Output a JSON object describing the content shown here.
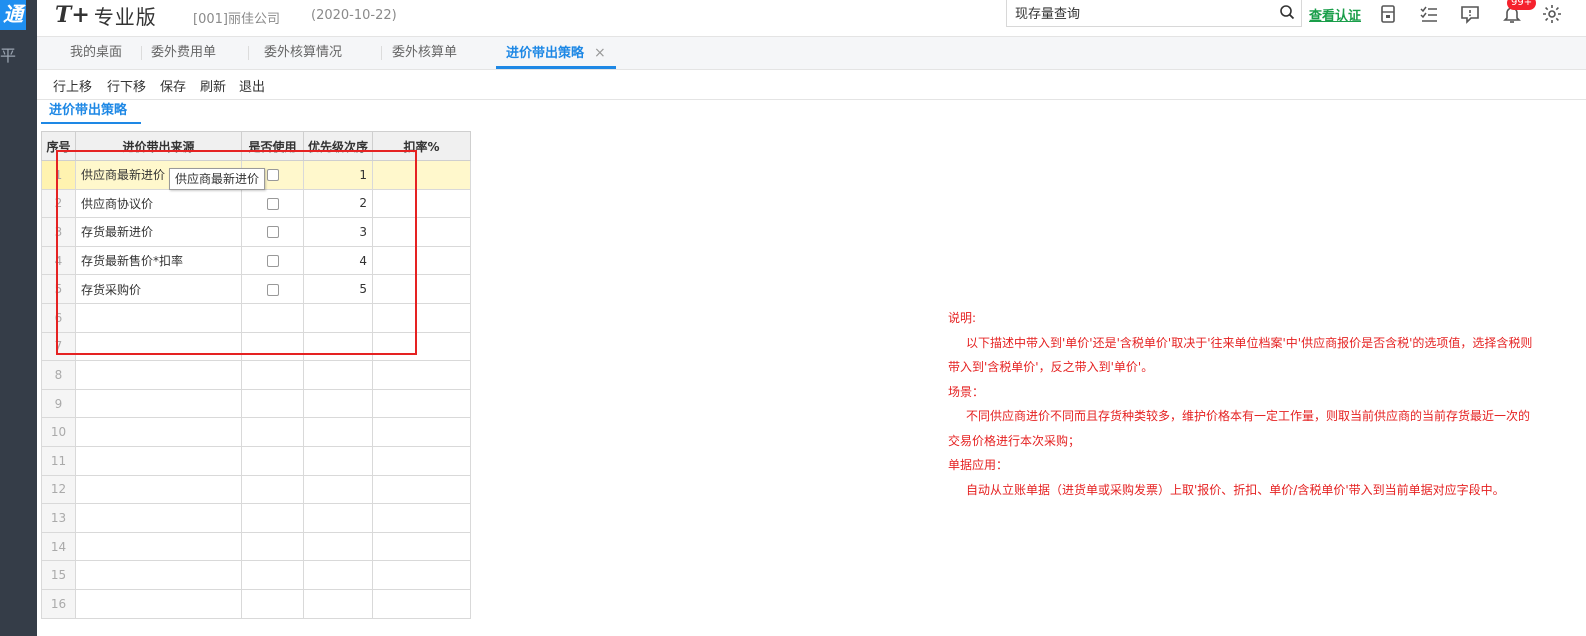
{
  "sidebar": {
    "logo_glyph": "通",
    "rail_glyph": "平"
  },
  "header": {
    "brand_mark": "T+",
    "brand_name": "专业版",
    "company": "[001]丽佳公司",
    "date": "(2020-10-22)",
    "search": {
      "value": "现存量查询",
      "placeholder": ""
    },
    "auth_link": "查看认证",
    "badge_count": "99+"
  },
  "tabs": [
    {
      "label": "我的桌面",
      "active": false
    },
    {
      "label": "委外费用单",
      "active": false
    },
    {
      "label": "委外核算情况",
      "active": false
    },
    {
      "label": "委外核算单",
      "active": false
    },
    {
      "label": "进价带出策略",
      "active": true,
      "close": "×"
    }
  ],
  "toolbar": [
    "行上移",
    "行下移",
    "保存",
    "刷新",
    "退出"
  ],
  "subtab": "进价带出策略",
  "grid": {
    "columns": [
      "序号",
      "进价带出来源",
      "是否使用",
      "优先级次序",
      "扣率%"
    ],
    "rows": [
      {
        "no": "1",
        "source": "供应商最新进价",
        "used": false,
        "priority": "1",
        "discount": "",
        "selected": true
      },
      {
        "no": "2",
        "source": "供应商协议价",
        "used": false,
        "priority": "2",
        "discount": ""
      },
      {
        "no": "3",
        "source": "存货最新进价",
        "used": false,
        "priority": "3",
        "discount": ""
      },
      {
        "no": "4",
        "source": "存货最新售价*扣率",
        "used": false,
        "priority": "4",
        "discount": ""
      },
      {
        "no": "5",
        "source": "存货采购价",
        "used": false,
        "priority": "5",
        "discount": ""
      },
      {
        "no": "6",
        "source": "",
        "used": null,
        "priority": "",
        "discount": ""
      },
      {
        "no": "7",
        "source": "",
        "used": null,
        "priority": "",
        "discount": ""
      },
      {
        "no": "8",
        "source": "",
        "used": null,
        "priority": "",
        "discount": ""
      },
      {
        "no": "9",
        "source": "",
        "used": null,
        "priority": "",
        "discount": ""
      },
      {
        "no": "10",
        "source": "",
        "used": null,
        "priority": "",
        "discount": ""
      },
      {
        "no": "11",
        "source": "",
        "used": null,
        "priority": "",
        "discount": ""
      },
      {
        "no": "12",
        "source": "",
        "used": null,
        "priority": "",
        "discount": ""
      },
      {
        "no": "13",
        "source": "",
        "used": null,
        "priority": "",
        "discount": ""
      },
      {
        "no": "14",
        "source": "",
        "used": null,
        "priority": "",
        "discount": ""
      },
      {
        "no": "15",
        "source": "",
        "used": null,
        "priority": "",
        "discount": ""
      },
      {
        "no": "16",
        "source": "",
        "used": null,
        "priority": "",
        "discount": ""
      }
    ]
  },
  "tooltip": "供应商最新进价",
  "notes": {
    "title1": "说明:",
    "body1": "以下描述中带入到'单价'还是'含税单价'取决于'往来单位档案'中'供应商报价是否含税'的选项值，选择含税则带入到'含税单价'，反之带入到'单价'。",
    "title2": "场景：",
    "body2": "不同供应商进价不同而且存货种类较多，维护价格本有一定工作量，则取当前供应商的当前存货最近一次的交易价格进行本次采购；",
    "title3": "单据应用：",
    "body3": "自动从立账单据（进货单或采购发票）上取'报价、折扣、单价/含税单价'带入到当前单据对应字段中。"
  },
  "colors": {
    "accent": "#1e88e5",
    "annotation": "#e52222",
    "auth_link": "#1a9e4a",
    "selected_row": "#fff8cc"
  }
}
